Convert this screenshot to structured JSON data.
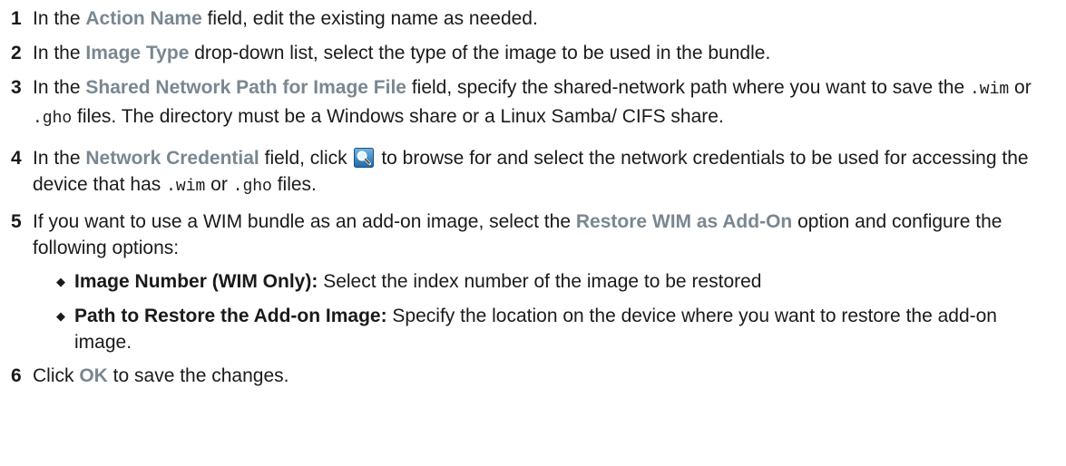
{
  "steps": [
    {
      "num": "1",
      "pre": "In the ",
      "ui": "Action Name",
      "post": " field, edit the existing name as needed."
    },
    {
      "num": "2",
      "pre": "In the ",
      "ui": "Image Type",
      "post": " drop-down list, select the type of the image to be used in the bundle."
    },
    {
      "num": "3",
      "pre": "In the ",
      "ui": "Shared Network Path for Image File",
      "mid": " field, specify the shared-network path where you want to save the ",
      "code1": ".wim",
      "or": " or ",
      "code2": ".gho",
      "post": " files. The directory must be a Windows share or a Linux Samba/ CIFS share."
    },
    {
      "num": "4",
      "pre": "In the ",
      "ui": "Network Credential",
      "mid": " field, click ",
      "icon": "search-icon",
      "mid2": " to browse for and select the network credentials to be used for accessing the device that has ",
      "code1": ".wim",
      "or": " or ",
      "code2": ".gho",
      "post": " files."
    },
    {
      "num": "5",
      "pre": "If you want to use a WIM bundle as an add-on image, select the ",
      "ui": "Restore WIM as Add-On",
      "post": " option and configure the following options:",
      "bullets": [
        {
          "mark": "◆",
          "term": "Image Number (WIM Only):",
          "desc": " Select the index number of the image to be restored"
        },
        {
          "mark": "◆",
          "term": "Path to Restore the Add-on Image:",
          "desc": " Specify the location on the device where you want to restore the add-on image."
        }
      ]
    },
    {
      "num": "6",
      "pre": "Click ",
      "ui": "OK",
      "post": " to save the changes."
    }
  ],
  "colors": {
    "ui_term": "#7a8791",
    "text": "#1a1a1a",
    "icon_bg": "#2f7fb8"
  }
}
